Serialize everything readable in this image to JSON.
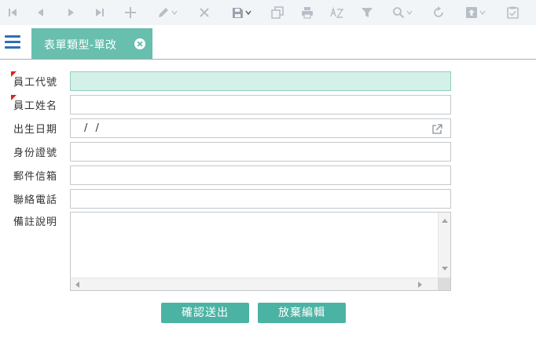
{
  "toolbar": {
    "icons": [
      "first-record-icon",
      "previous-record-icon",
      "next-record-icon",
      "last-record-icon",
      "add-icon",
      "edit-icon",
      "delete-icon",
      "save-icon",
      "copy-icon",
      "print-icon",
      "sort-az-icon",
      "filter-icon",
      "search-icon",
      "refresh-icon",
      "export-icon",
      "clipboard-icon"
    ]
  },
  "tab": {
    "title": "表單類型-單改"
  },
  "form": {
    "fields": {
      "employee_id": {
        "label": "員工代號",
        "required": true,
        "value": ""
      },
      "employee_name": {
        "label": "員工姓名",
        "required": true,
        "value": ""
      },
      "birth_date": {
        "label": "出生日期",
        "value": "/ /"
      },
      "id_number": {
        "label": "身份證號",
        "value": ""
      },
      "email": {
        "label": "郵件信箱",
        "value": ""
      },
      "phone": {
        "label": "聯絡電話",
        "value": ""
      },
      "remarks": {
        "label": "備註說明",
        "value": ""
      }
    }
  },
  "actions": {
    "submit_label": "確認送出",
    "cancel_label": "放棄編輯"
  },
  "colors": {
    "accent": "#4bb3a4",
    "tab": "#68bfae",
    "required_marker": "#e02020",
    "highlight_field": "#d5f0e8",
    "menu": "#2e6fb5"
  }
}
